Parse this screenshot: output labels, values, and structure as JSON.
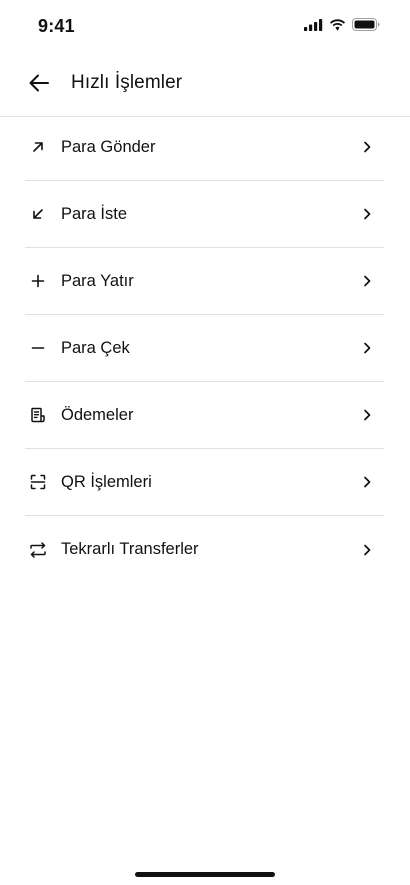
{
  "status_bar": {
    "time": "9:41"
  },
  "header": {
    "title": "Hızlı İşlemler",
    "back_icon": "arrow-left-icon"
  },
  "menu": {
    "items": [
      {
        "label": "Para Gönder",
        "icon": "arrow-up-right-icon"
      },
      {
        "label": "Para İste",
        "icon": "arrow-down-left-icon"
      },
      {
        "label": "Para Yatır",
        "icon": "plus-icon"
      },
      {
        "label": "Para Çek",
        "icon": "minus-icon"
      },
      {
        "label": "Ödemeler",
        "icon": "receipt-icon"
      },
      {
        "label": "QR İşlemleri",
        "icon": "qr-scan-icon"
      },
      {
        "label": "Tekrarlı Transferler",
        "icon": "repeat-icon"
      }
    ]
  }
}
